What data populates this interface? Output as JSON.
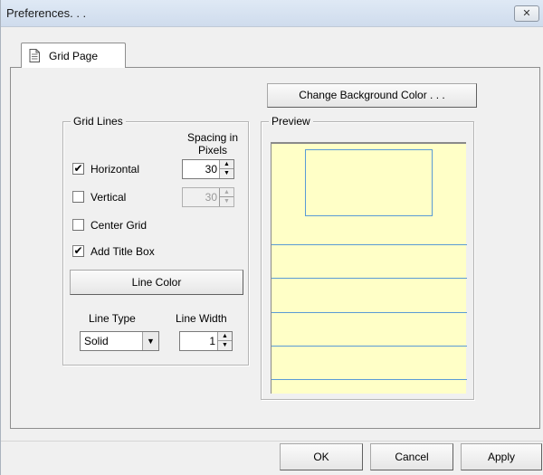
{
  "window": {
    "title": "Preferences. . ."
  },
  "tabs": [
    {
      "label": "Grid Page"
    }
  ],
  "buttons": {
    "change_bg": "Change Background Color . . .",
    "line_color": "Line Color",
    "ok": "OK",
    "cancel": "Cancel",
    "apply": "Apply"
  },
  "grid_lines": {
    "legend": "Grid Lines",
    "spacing_header_1": "Spacing in",
    "spacing_header_2": "Pixels",
    "horizontal": {
      "label": "Horizontal",
      "checked": true,
      "spacing": "30"
    },
    "vertical": {
      "label": "Vertical",
      "checked": false,
      "spacing": "30"
    },
    "center_grid": {
      "label": "Center Grid",
      "checked": false
    },
    "add_title_box": {
      "label": "Add Title Box",
      "checked": true
    },
    "line_type_label": "Line Type",
    "line_width_label": "Line Width",
    "line_type_value": "Solid",
    "line_width_value": "1"
  },
  "preview": {
    "legend": "Preview",
    "background": "#ffffc7",
    "line_color": "#5a9bd5"
  },
  "icons": {
    "close": "close-icon",
    "doc": "document-icon"
  },
  "check_mark": "✔"
}
